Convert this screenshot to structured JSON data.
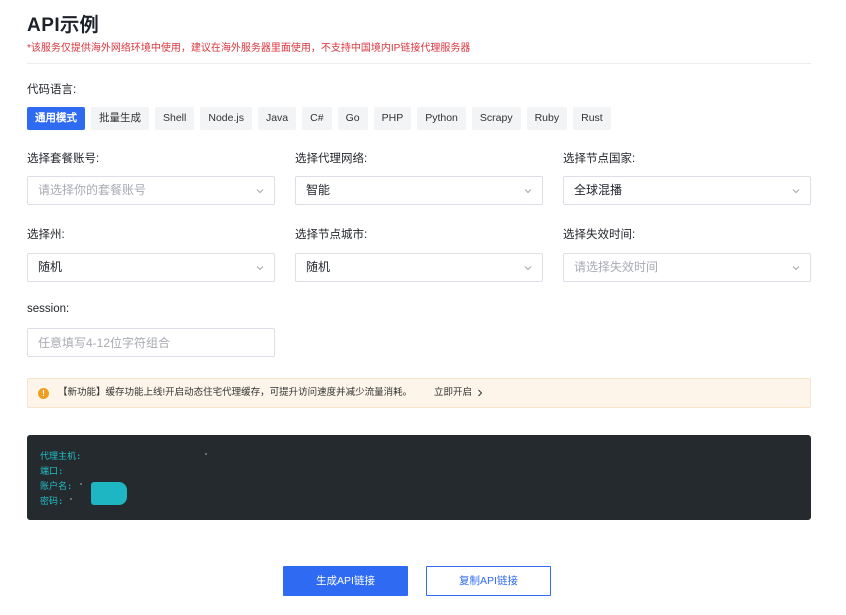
{
  "page": {
    "title": "API示例",
    "notice": "*该服务仅提供海外网络环境中使用，建议在海外服务器里面使用，不支持中国境内IP链接代理服务器"
  },
  "language": {
    "label": "代码语言:",
    "options": [
      "通用模式",
      "批量生成",
      "Shell",
      "Node.js",
      "Java",
      "C#",
      "Go",
      "PHP",
      "Python",
      "Scrapy",
      "Ruby",
      "Rust"
    ],
    "selected": "通用模式"
  },
  "fields": {
    "package": {
      "label": "选择套餐账号:",
      "placeholder": "请选择你的套餐账号",
      "value": ""
    },
    "network": {
      "label": "选择代理网络:",
      "value": "智能"
    },
    "country": {
      "label": "选择节点国家:",
      "value": "全球混播"
    },
    "state": {
      "label": "选择州:",
      "value": "随机"
    },
    "city": {
      "label": "选择节点城市:",
      "value": "随机"
    },
    "expiry": {
      "label": "选择失效时间:",
      "placeholder": "请选择失效时间",
      "value": ""
    },
    "session": {
      "label": "session:",
      "placeholder": "任意填写4-12位字符组合",
      "value": ""
    }
  },
  "banner": {
    "icon": "warning-icon",
    "message": "【新功能】缓存功能上线!开启动态住宅代理缓存，可提升访问速度并减少流量消耗。",
    "link": "立即开启"
  },
  "output": {
    "lines": [
      "代理主机:",
      "端口:",
      "账户名:",
      "密码:"
    ]
  },
  "actions": {
    "generate": "生成API链接",
    "copy": "复制API链接"
  },
  "colors": {
    "primary": "#2f6bf2",
    "notice": "#d9363e",
    "code_bg": "#252a2e",
    "code_text": "#21c0c9",
    "banner_bg": "#fdf4ea"
  }
}
